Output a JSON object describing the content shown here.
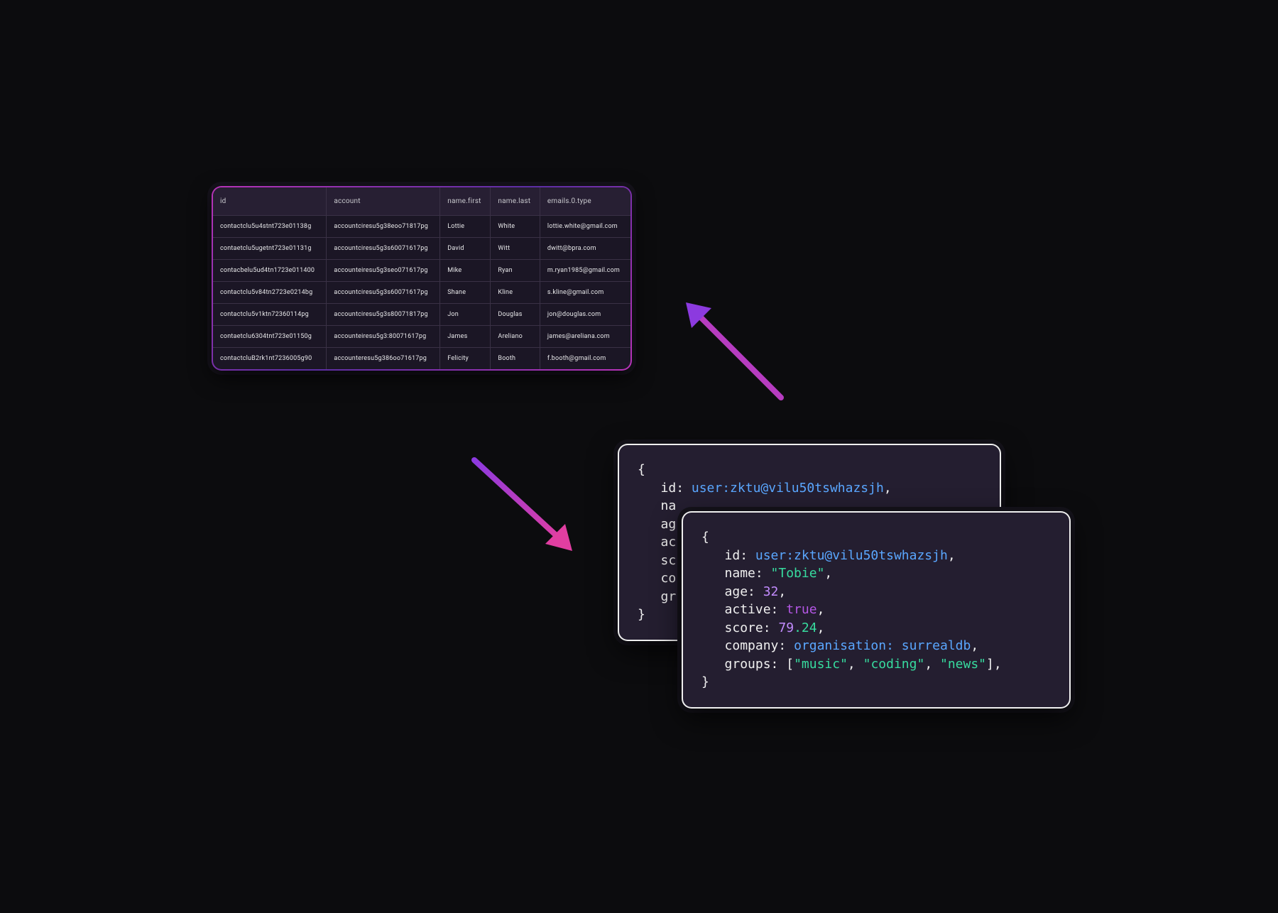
{
  "table": {
    "headers": [
      "id",
      "account",
      "name.first",
      "name.last",
      "emails.0.type"
    ],
    "rows": [
      {
        "id": "contactclu5u4stnt723e01138g",
        "account": "accountciresu5g38eoo71817pg",
        "first": "Lottie",
        "last": "White",
        "email": "lottie.white@gmail.com"
      },
      {
        "id": "contaetclu5ugetnt723e01131g",
        "account": "accountciresu5g3s60071617pg",
        "first": "David",
        "last": "Witt",
        "email": "dwitt@bpra.com"
      },
      {
        "id": "contacbelu5ud4tn1723e011400",
        "account": "accounteiresu5g3seo071617pg",
        "first": "Mike",
        "last": "Ryan",
        "email": "m.ryan1985@gmail.com"
      },
      {
        "id": "contactclu5v84tn2723e0214bg",
        "account": "accountciresu5g3s60071617pg",
        "first": "Shane",
        "last": "Kline",
        "email": "s.kline@gmail.com"
      },
      {
        "id": "contactclu5v1ktn72360114pg",
        "account": "accountciresu5g3s80071817pg",
        "first": "Jon",
        "last": "Douglas",
        "email": "jon@douglas.com"
      },
      {
        "id": "contaetclu6304tnt723e01150g",
        "account": "accounteiresu5g3:80071617pg",
        "first": "James",
        "last": "Areliano",
        "email": "james@areliana.com"
      },
      {
        "id": "contactcluB2rk1nt7236005g90",
        "account": "accounteresu5g386oo71617pg",
        "first": "Felicity",
        "last": "Booth",
        "email": "f.booth@gmail.com"
      }
    ]
  },
  "code_back": {
    "open": "{",
    "id_key": "id:",
    "id_val": "user:zktu@vilu50tswhazsjh",
    "name_key": "na",
    "age_key": "ag",
    "active_key": "ac",
    "score_key": "sc",
    "company_key": "co",
    "groups_key": "gr",
    "close": "}"
  },
  "code_front": {
    "open": "{",
    "id_key": "id:",
    "id_val": "user:zktu@vilu50tswhazsjh",
    "name_key": "name:",
    "name_val": "\"Tobie\"",
    "age_key": "age:",
    "age_val": "32",
    "active_key": "active:",
    "active_val": "true",
    "score_key": "score:",
    "score_int": "79",
    "score_dec": ".24",
    "company_key": "company:",
    "company_rel": "organisation:",
    "company_val": "surrealdb",
    "groups_key": "groups:",
    "groups_open": "[",
    "groups_0": "\"music\"",
    "groups_1": "\"coding\"",
    "groups_2": "\"news\"",
    "groups_close": "]",
    "comma": ",",
    "close": "}"
  }
}
